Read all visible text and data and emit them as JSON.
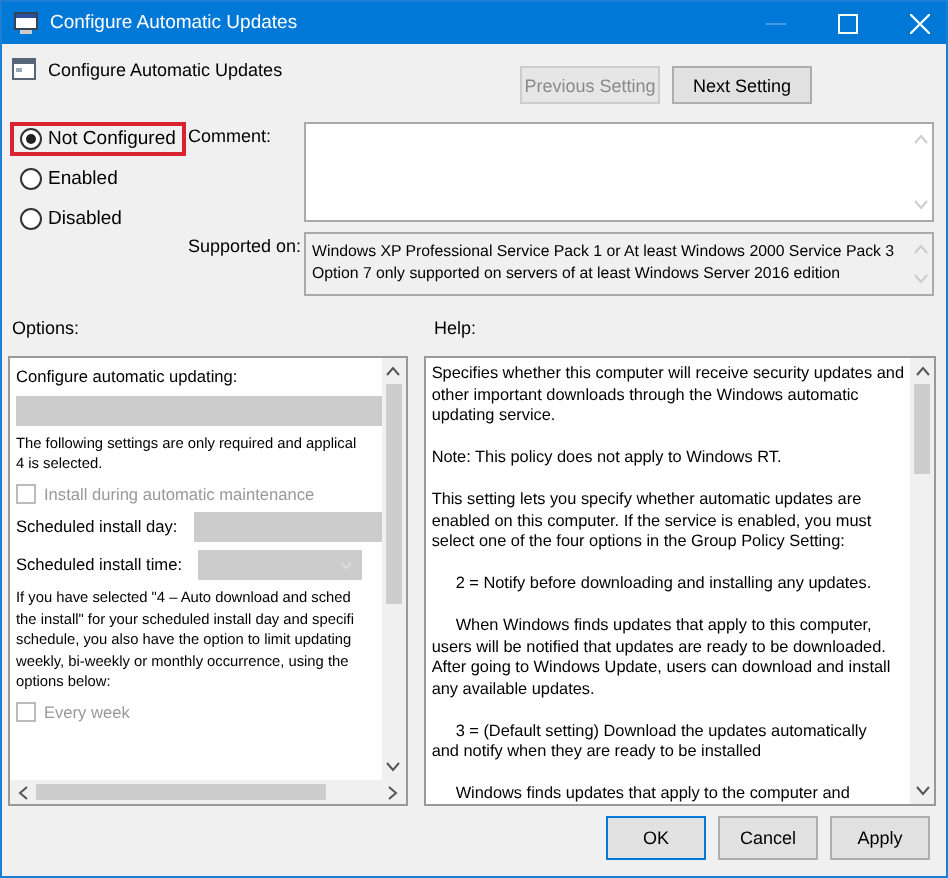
{
  "window": {
    "title": "Configure Automatic Updates"
  },
  "header": {
    "title": "Configure Automatic Updates"
  },
  "nav_buttons": [
    {
      "label": "Previous Setting",
      "disabled": true
    },
    {
      "label": "Next Setting",
      "disabled": false
    }
  ],
  "states": [
    {
      "label": "Not Configured",
      "selected": true,
      "highlighted": true
    },
    {
      "label": "Enabled",
      "selected": false,
      "highlighted": false
    },
    {
      "label": "Disabled",
      "selected": false,
      "highlighted": false
    }
  ],
  "comment": {
    "label": "Comment:"
  },
  "supported_on": {
    "label": "Supported on:",
    "lines": [
      "Windows XP Professional Service Pack 1 or At least Windows 2000 Service Pack 3",
      "Option 7 only supported on servers of at least Windows Server 2016 edition"
    ]
  },
  "options": {
    "label": "Options:",
    "items": [
      {
        "kind": "label",
        "text": "Configure automatic updating:"
      },
      {
        "kind": "dropdown"
      },
      {
        "kind": "text",
        "lines": [
          "The following settings are only required and applical",
          "4 is selected."
        ]
      },
      {
        "kind": "checkbox",
        "text": "Install during automatic maintenance",
        "checked": false,
        "disabled": true
      },
      {
        "kind": "field",
        "text": "Scheduled install day:"
      },
      {
        "kind": "combo",
        "text": "Scheduled install time:"
      },
      {
        "kind": "text",
        "lines": [
          "If you have selected \"4 – Auto download and sched",
          "the install\" for your scheduled install day and specifi",
          "schedule, you also have the option to limit updating",
          "weekly, bi-weekly or monthly occurrence, using the",
          "options below:"
        ]
      },
      {
        "kind": "checkbox",
        "text": "Every week",
        "checked": false,
        "disabled": true
      }
    ]
  },
  "help": {
    "label": "Help:",
    "paragraphs": [
      {
        "indent": false,
        "lines": [
          "Specifies whether this computer will receive security updates and",
          "other important downloads through the Windows automatic",
          "updating service."
        ]
      },
      {
        "indent": false,
        "lines": [
          "Note: This policy does not apply to Windows RT."
        ]
      },
      {
        "indent": false,
        "lines": [
          "This setting lets you specify whether automatic updates are",
          "enabled on this computer. If the service is enabled, you must",
          "select one of the four options in the Group Policy Setting:"
        ]
      },
      {
        "indent": true,
        "lines": [
          "2 = Notify before downloading and installing any updates."
        ]
      },
      {
        "indent": true,
        "lines": [
          "When Windows finds updates that apply to this computer,",
          "users will be notified that updates are ready to be downloaded.",
          "After going to Windows Update, users can download and install",
          "any available updates."
        ]
      },
      {
        "indent": true,
        "lines": [
          "3 = (Default setting) Download the updates automatically",
          "and notify when they are ready to be installed"
        ]
      },
      {
        "indent": true,
        "lines": [
          "Windows finds updates that apply to the computer and"
        ]
      }
    ]
  },
  "footer_buttons": [
    {
      "label": "OK",
      "default": true
    },
    {
      "label": "Cancel",
      "default": false
    },
    {
      "label": "Apply",
      "default": false
    }
  ]
}
